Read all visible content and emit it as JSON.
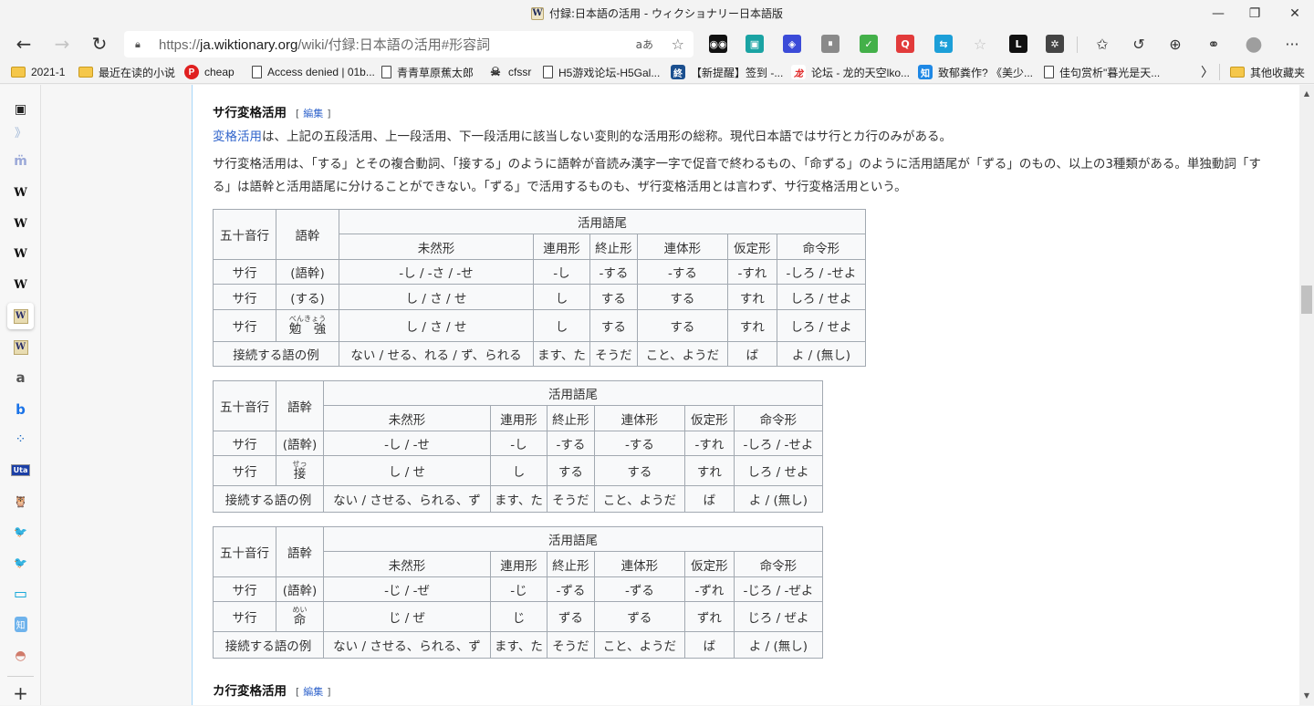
{
  "window": {
    "title": "付録:日本語の活用 - ウィクショナリー日本語版",
    "favicon": "W",
    "controls": {
      "minimize": "—",
      "restore": "❐",
      "close": "✕"
    }
  },
  "toolbar": {
    "back": "←",
    "forward": "→",
    "refresh": "↻",
    "url_prefix": "https://",
    "url_domain": "ja.wiktionary.org",
    "url_path": "/wiki/付録:日本語の活用#形容詞",
    "read_aloud": "aあ",
    "add_favorite": "☆",
    "extensions": [
      {
        "name": "tampermonkey-icon",
        "glyph": "◉◉",
        "color": "#111111"
      },
      {
        "name": "save-icon",
        "glyph": "▣",
        "color": "#1aa3a3"
      },
      {
        "name": "cube-icon",
        "glyph": "◈",
        "color": "#3b4bd8"
      },
      {
        "name": "paused-extension-icon",
        "glyph": "⏸",
        "color": "#8a8a8a"
      },
      {
        "name": "adguard-icon",
        "glyph": "✓",
        "color": "#43b049"
      },
      {
        "name": "search-ext-icon",
        "glyph": "Q",
        "color": "#e23b3b"
      },
      {
        "name": "translate-icon",
        "glyph": "⇆",
        "color": "#1c9fd8"
      },
      {
        "name": "star-ext-icon",
        "glyph": "☆",
        "color": "#bdbdbd"
      },
      {
        "name": "l-ext-icon",
        "glyph": "L",
        "color": "#111111"
      },
      {
        "name": "extensions-puzzle-icon",
        "glyph": "✲",
        "color": "#444444"
      }
    ],
    "right_buttons": [
      {
        "name": "favorites-icon",
        "glyph": "✩"
      },
      {
        "name": "history-icon",
        "glyph": "↺"
      },
      {
        "name": "collections-icon",
        "glyph": "⊕"
      },
      {
        "name": "share-icon",
        "glyph": "⚭"
      },
      {
        "name": "profile-avatar",
        "glyph": "●"
      },
      {
        "name": "more-menu-icon",
        "glyph": "···"
      }
    ]
  },
  "bookmarks": {
    "items": [
      {
        "type": "folder",
        "label": "2021-1"
      },
      {
        "type": "folder",
        "label": "最近在读的小说"
      },
      {
        "type": "fav",
        "label": "cheap",
        "icon": "P",
        "color": "#e02020"
      },
      {
        "type": "page",
        "label": "Access denied | 01b..."
      },
      {
        "type": "page",
        "label": "青青草原蕉太郎"
      },
      {
        "type": "fav",
        "label": "cfssr",
        "icon": "☠",
        "color": "#555555"
      },
      {
        "type": "page",
        "label": "H5游戏论坛-H5Gal..."
      },
      {
        "type": "fav",
        "label": "【新提醒】签到 -...",
        "icon": "終",
        "color": "#1b4f8f"
      },
      {
        "type": "fav",
        "label": "论坛 - 龙的天空lko...",
        "icon": "龙",
        "color": "#ffffff"
      },
      {
        "type": "fav",
        "label": "致郁粪作? 《美少...",
        "icon": "知",
        "color": "#1e88e5"
      },
      {
        "type": "page",
        "label": "佳句赏析\"暮光是天..."
      }
    ],
    "overflow": "〉",
    "other_folder": "其他收藏夹"
  },
  "sidebar": {
    "items": [
      {
        "name": "sidebar-item-app",
        "glyph": "▣"
      },
      {
        "name": "sidebar-item-books",
        "glyph": "》"
      },
      {
        "name": "sidebar-item-m",
        "glyph": "m̈"
      },
      {
        "name": "sidebar-item-wikipedia-1",
        "glyph": "W"
      },
      {
        "name": "sidebar-item-wikipedia-2",
        "glyph": "W"
      },
      {
        "name": "sidebar-item-wikipedia-3",
        "glyph": "W"
      },
      {
        "name": "sidebar-item-wikipedia-4",
        "glyph": "W"
      },
      {
        "name": "sidebar-item-wiktionary-active",
        "glyph": "W"
      },
      {
        "name": "sidebar-item-wiktionary",
        "glyph": "W"
      },
      {
        "name": "sidebar-item-amazon",
        "glyph": "a"
      },
      {
        "name": "sidebar-item-bing",
        "glyph": "b"
      },
      {
        "name": "sidebar-item-dots",
        "glyph": "⁘"
      },
      {
        "name": "sidebar-item-uta",
        "glyph": "Uta"
      },
      {
        "name": "sidebar-item-owl",
        "glyph": "🦉"
      },
      {
        "name": "sidebar-item-twitter-1",
        "glyph": "🐦"
      },
      {
        "name": "sidebar-item-twitter-2",
        "glyph": "🐦"
      },
      {
        "name": "sidebar-item-bilibili",
        "glyph": "▭"
      },
      {
        "name": "sidebar-item-zhihu",
        "glyph": "知"
      },
      {
        "name": "sidebar-item-avatar",
        "glyph": "◓"
      }
    ],
    "add": "+"
  },
  "article": {
    "section1": {
      "title": "サ行変格活用",
      "edit": "編集"
    },
    "para1_link": "変格活用",
    "para1_rest": "は、上記の五段活用、上一段活用、下一段活用に該当しない変則的な活用形の総称。現代日本語ではサ行とカ行のみがある。",
    "para2": "サ行変格活用は、「する」とその複合動詞、「接する」のように語幹が音読み漢字一字で促音で終わるもの、「命ずる」のように活用語尾が「ずる」のもの、以上の3種類がある。単独動詞「する」は語幹と活用語尾に分けることができない。「ずる」で活用するものも、ザ行変格活用とは言わず、サ行変格活用という。",
    "section2": {
      "title": "カ行変格活用",
      "edit": "編集"
    }
  },
  "tables": [
    {
      "headers": {
        "row": "五十音行",
        "stem": "語幹",
        "ending": "活用語尾",
        "forms": [
          "未然形",
          "連用形",
          "終止形",
          "連体形",
          "仮定形",
          "命令形"
        ]
      },
      "rows": [
        {
          "row": "サ行",
          "stem": "(語幹)",
          "ruby": "",
          "cells": [
            "-し / -さ / -せ",
            "-し",
            "-する",
            "-する",
            "-すれ",
            "-しろ / -せよ"
          ]
        },
        {
          "row": "サ行",
          "stem": "(する)",
          "ruby": "",
          "cells": [
            "し / さ / せ",
            "し",
            "する",
            "する",
            "すれ",
            "しろ / せよ"
          ]
        },
        {
          "row": "サ行",
          "stem": "勉　強",
          "ruby": "べんきょう",
          "cells": [
            "し / さ / せ",
            "し",
            "する",
            "する",
            "すれ",
            "しろ / せよ"
          ]
        }
      ],
      "example_label": "接続する語の例",
      "examples": [
        "ない / せる、れる / ず、られる",
        "ます、た",
        "そうだ",
        "こと、ようだ",
        "ば",
        "よ / (無し)"
      ]
    },
    {
      "headers": {
        "row": "五十音行",
        "stem": "語幹",
        "ending": "活用語尾",
        "forms": [
          "未然形",
          "連用形",
          "終止形",
          "連体形",
          "仮定形",
          "命令形"
        ]
      },
      "rows": [
        {
          "row": "サ行",
          "stem": "(語幹)",
          "ruby": "",
          "cells": [
            "-し / -せ",
            "-し",
            "-する",
            "-する",
            "-すれ",
            "-しろ / -せよ"
          ]
        },
        {
          "row": "サ行",
          "stem": "接",
          "ruby": "せっ",
          "cells": [
            "し / せ",
            "し",
            "する",
            "する",
            "すれ",
            "しろ / せよ"
          ]
        }
      ],
      "example_label": "接続する語の例",
      "examples": [
        "ない / させる、られる、ず",
        "ます、た",
        "そうだ",
        "こと、ようだ",
        "ば",
        "よ / (無し)"
      ]
    },
    {
      "headers": {
        "row": "五十音行",
        "stem": "語幹",
        "ending": "活用語尾",
        "forms": [
          "未然形",
          "連用形",
          "終止形",
          "連体形",
          "仮定形",
          "命令形"
        ]
      },
      "rows": [
        {
          "row": "サ行",
          "stem": "(語幹)",
          "ruby": "",
          "cells": [
            "-じ / -ぜ",
            "-じ",
            "-ずる",
            "-ずる",
            "-ずれ",
            "-じろ / -ぜよ"
          ]
        },
        {
          "row": "サ行",
          "stem": "命",
          "ruby": "めい",
          "cells": [
            "じ / ぜ",
            "じ",
            "ずる",
            "ずる",
            "ずれ",
            "じろ / ぜよ"
          ]
        }
      ],
      "example_label": "接続する語の例",
      "examples": [
        "ない / させる、られる、ず",
        "ます、た",
        "そうだ",
        "こと、ようだ",
        "ば",
        "よ / (無し)"
      ]
    }
  ],
  "scrollbar": {
    "up": "▲",
    "down": "▼",
    "position_fraction": 0.33
  }
}
